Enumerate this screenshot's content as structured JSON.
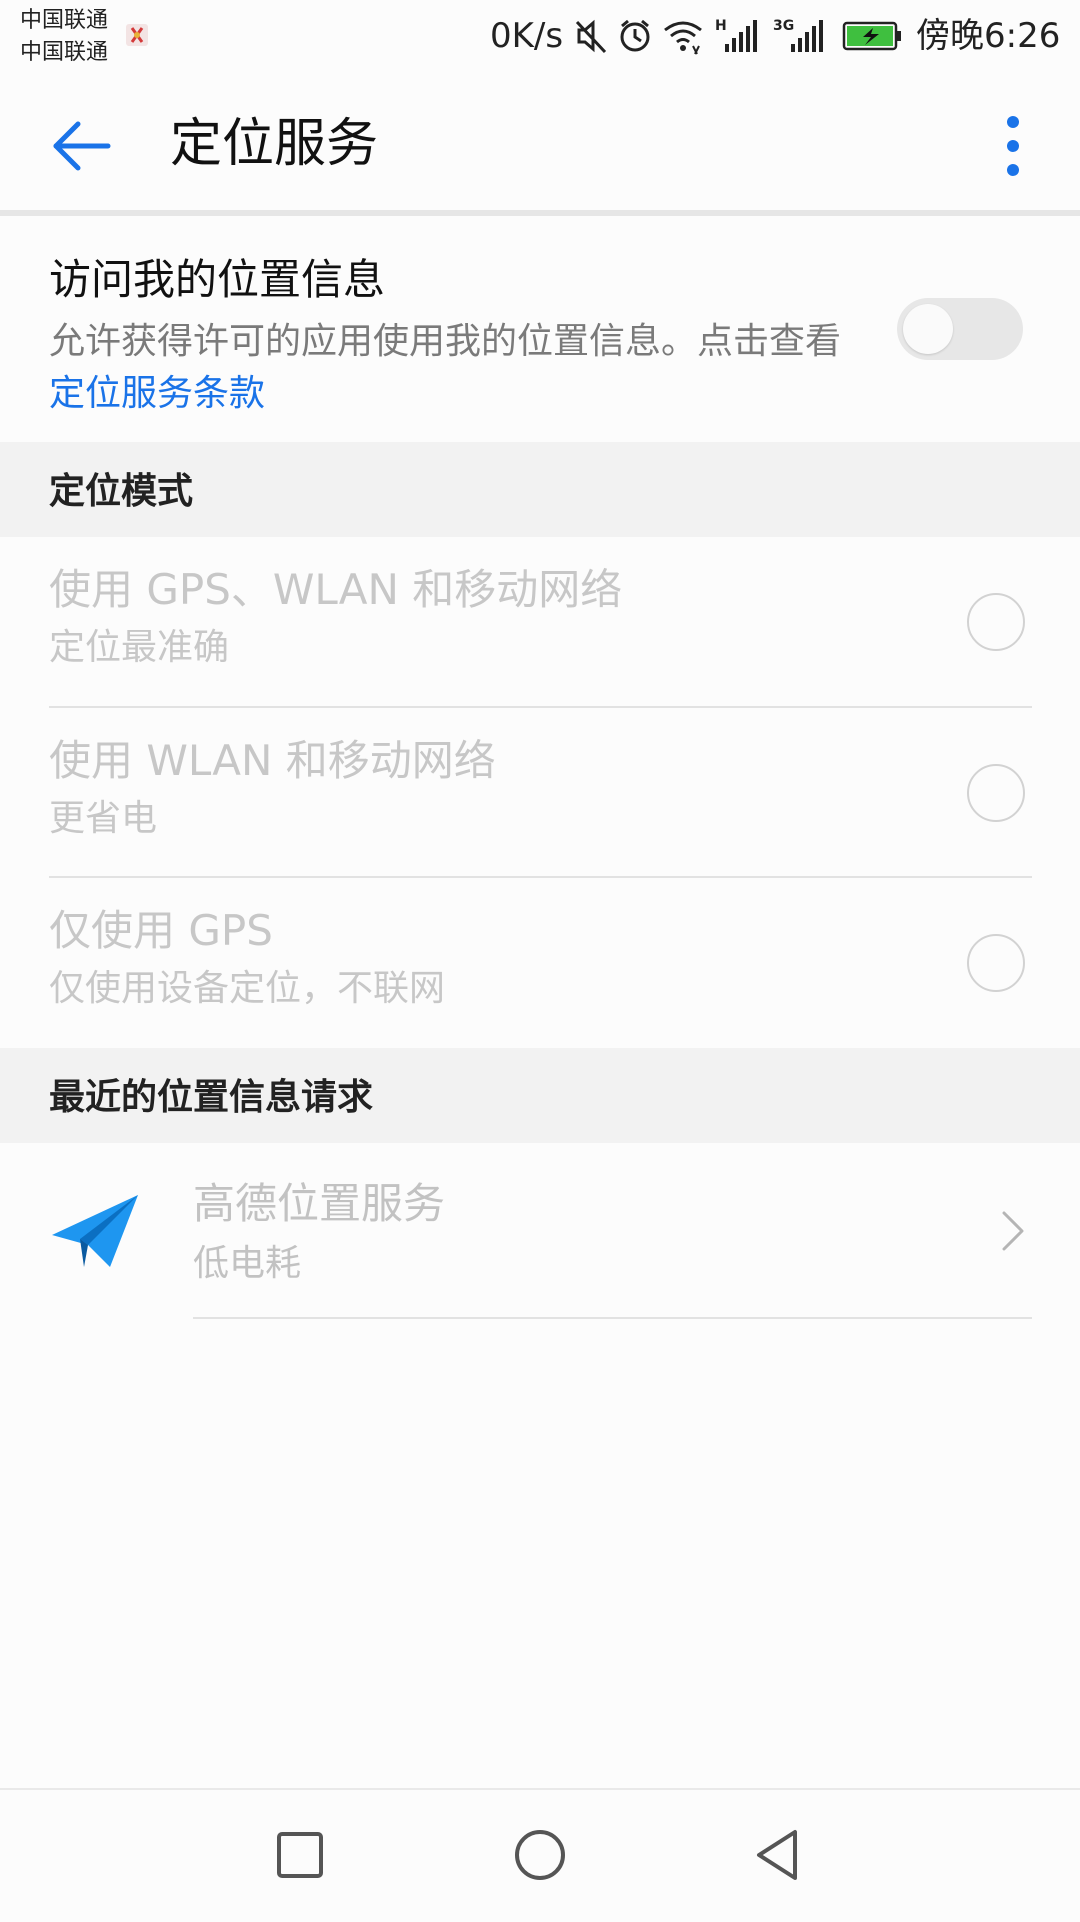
{
  "status_bar": {
    "carrier_1": "中国联通",
    "carrier_2": "中国联通",
    "net_speed": "0K/s",
    "time": "傍晚6:26",
    "signal_1_label": "H",
    "signal_2_label": "3G",
    "icons": [
      "mute-icon",
      "alarm-icon",
      "wifi-icon",
      "signal-icon",
      "battery-charging-icon"
    ],
    "colors": {
      "battery_fill": "#3fbf3f"
    }
  },
  "app_bar": {
    "title": "定位服务",
    "back_icon": "arrow-left-icon",
    "more_icon": "more-vertical-icon",
    "accent_color": "#1a73e8"
  },
  "location_access": {
    "title": "访问我的位置信息",
    "description": "允许获得许可的应用使用我的位置信息。点击查看",
    "link_text": "定位服务条款",
    "enabled": false
  },
  "location_mode": {
    "header": "定位模式",
    "options": [
      {
        "title": "使用 GPS、WLAN 和移动网络",
        "subtitle": "定位最准确",
        "selected": false
      },
      {
        "title": "使用 WLAN 和移动网络",
        "subtitle": "更省电",
        "selected": false
      },
      {
        "title": "仅使用 GPS",
        "subtitle": "仅使用设备定位，不联网",
        "selected": false
      }
    ]
  },
  "recent_requests": {
    "header": "最近的位置信息请求",
    "items": [
      {
        "name": "高德位置服务",
        "usage": "低电耗",
        "icon": "paper-plane-icon"
      }
    ]
  },
  "nav_bar": {
    "icons": [
      "recent-apps-icon",
      "home-icon",
      "back-icon"
    ]
  }
}
